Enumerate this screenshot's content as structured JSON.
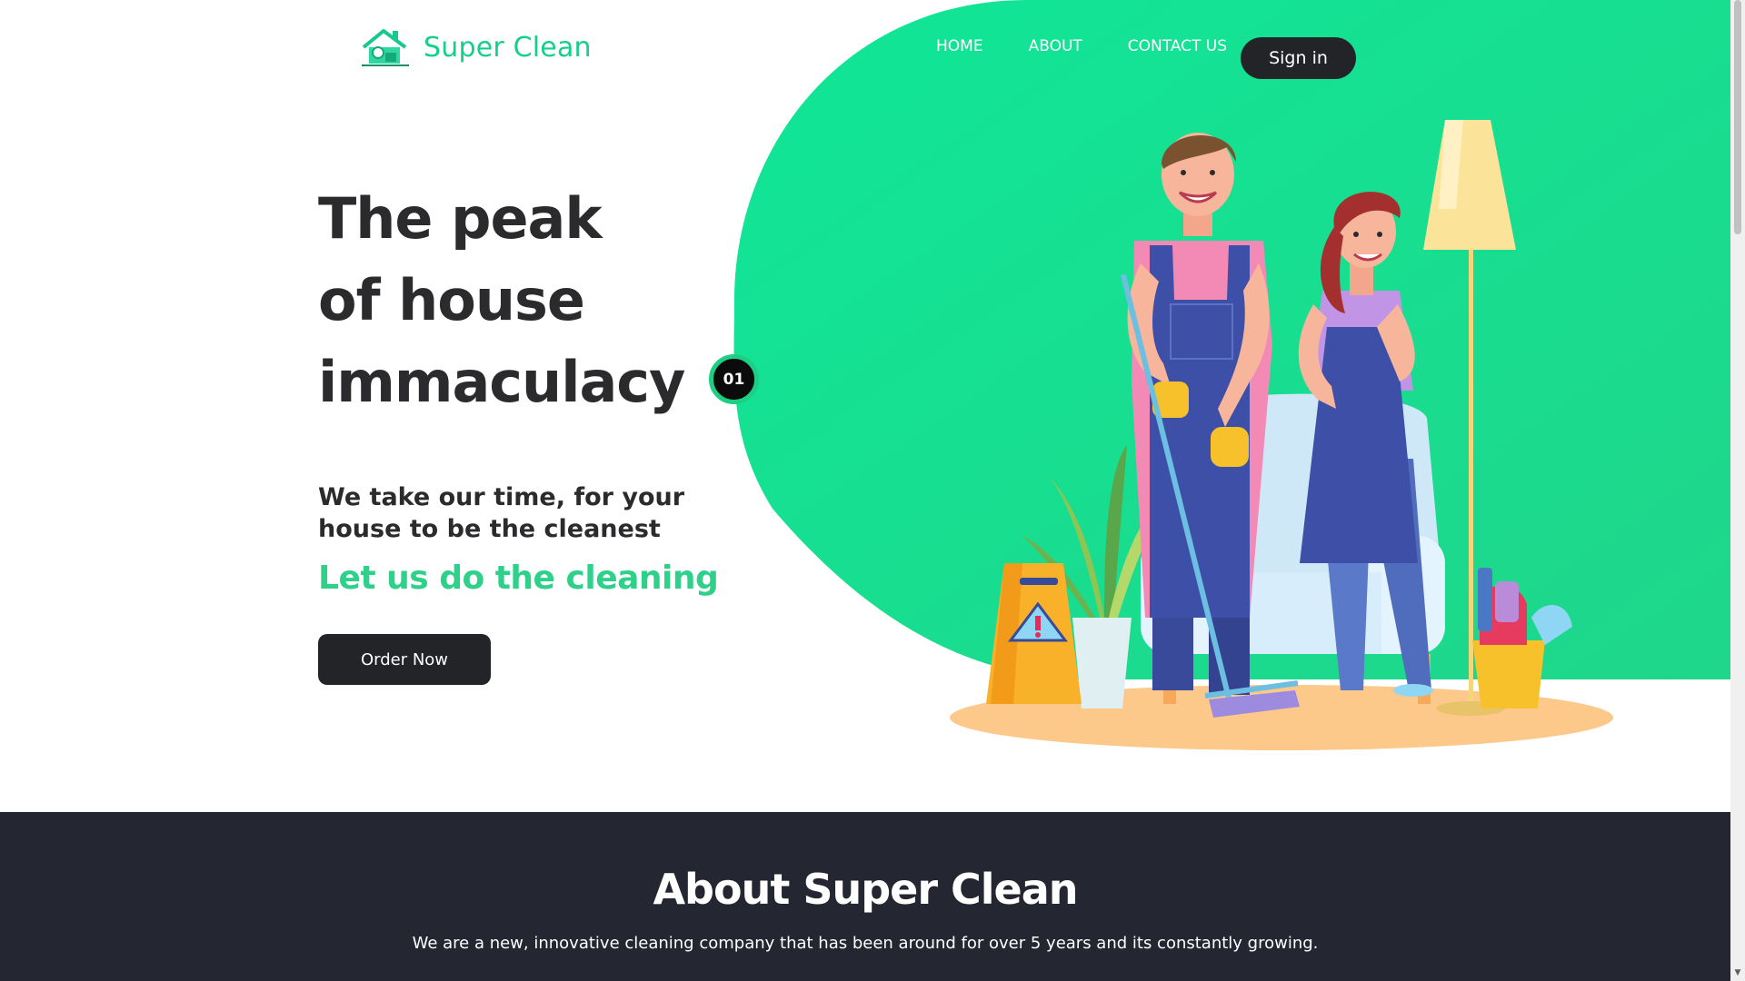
{
  "brand": {
    "name": "Super Clean",
    "accent_color": "#16cf8a",
    "dark_color": "#222428"
  },
  "nav": {
    "items": [
      {
        "label": "HOME"
      },
      {
        "label": "ABOUT"
      },
      {
        "label": "CONTACT US"
      }
    ],
    "signin_label": "Sign in"
  },
  "hero": {
    "title_lines": [
      "The peak",
      "of house",
      "immaculacy"
    ],
    "subtitle": "We take our time, for your house to be the cleanest",
    "accent": "Let us do the cleaning",
    "cta_label": "Order Now",
    "slide_number": "01",
    "illustration": "cleaning-crew-illustration"
  },
  "about": {
    "title": "About Super Clean",
    "text": "We are a new, innovative cleaning company that has been around for over 5 years and its constantly growing."
  },
  "scrollbar": {
    "scroll_position": 0
  }
}
